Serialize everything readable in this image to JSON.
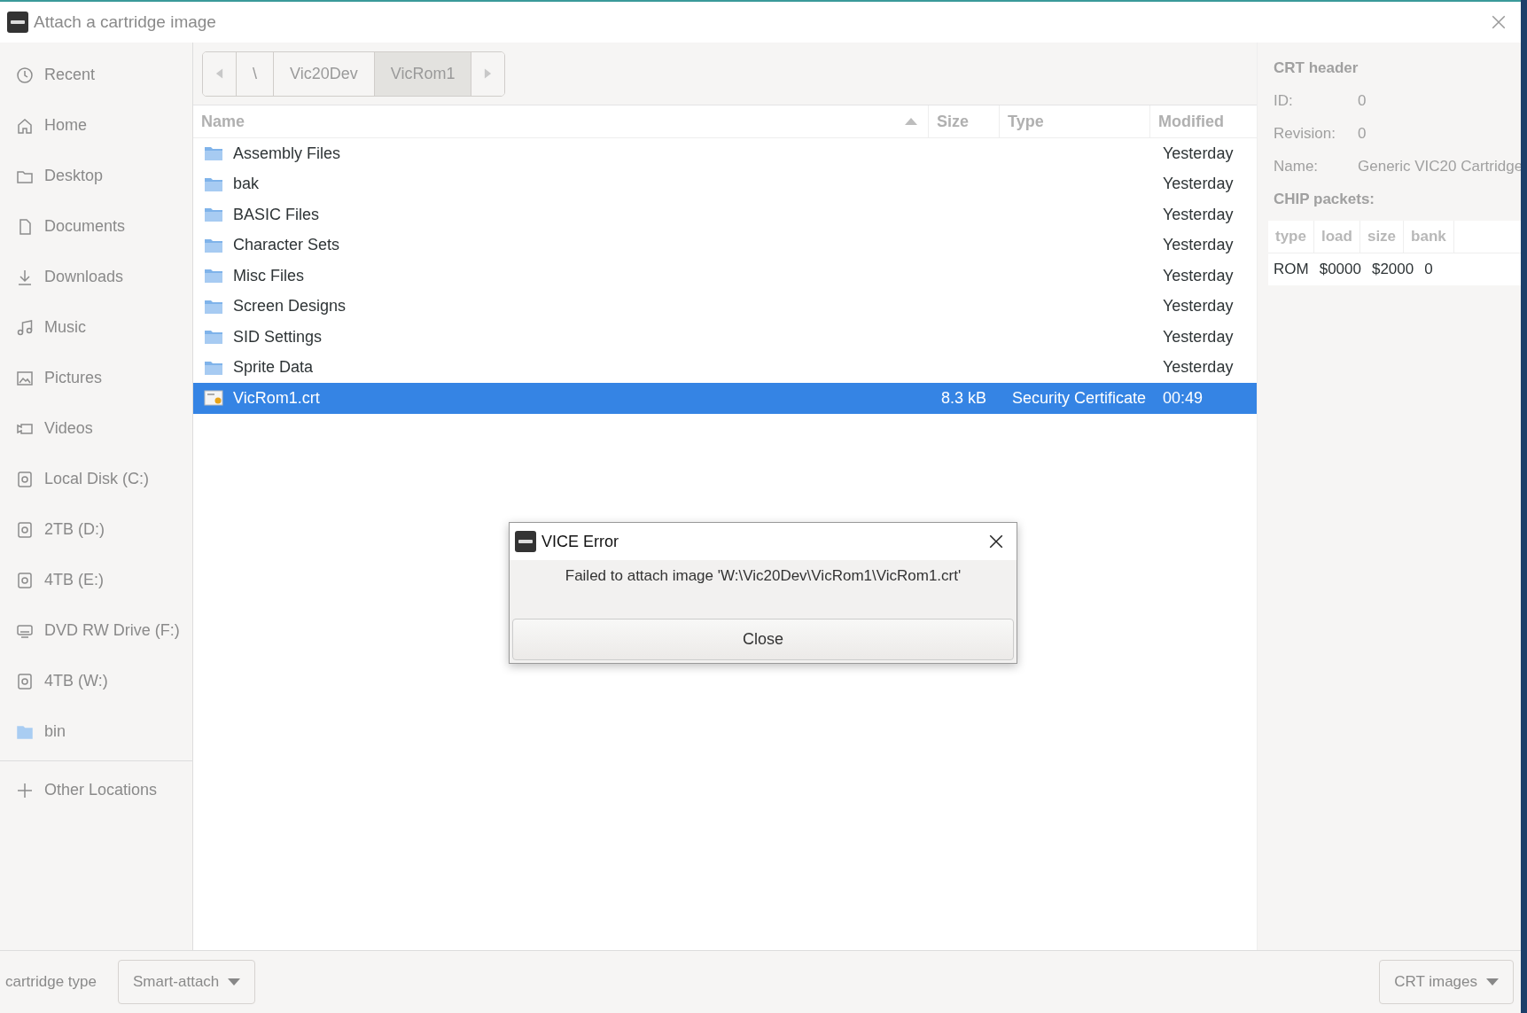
{
  "window": {
    "title": "Attach a cartridge image"
  },
  "sidebar": {
    "items": [
      {
        "kind": "recent",
        "label": "Recent"
      },
      {
        "kind": "home",
        "label": "Home"
      },
      {
        "kind": "folder",
        "label": "Desktop"
      },
      {
        "kind": "document",
        "label": "Documents"
      },
      {
        "kind": "download",
        "label": "Downloads"
      },
      {
        "kind": "music",
        "label": "Music"
      },
      {
        "kind": "picture",
        "label": "Pictures"
      },
      {
        "kind": "video",
        "label": "Videos"
      },
      {
        "kind": "disk",
        "label": "Local Disk (C:)"
      },
      {
        "kind": "disk",
        "label": "2TB (D:)"
      },
      {
        "kind": "disk",
        "label": "4TB (E:)"
      },
      {
        "kind": "optical",
        "label": "DVD RW Drive (F:)"
      },
      {
        "kind": "disk",
        "label": "4TB (W:)"
      },
      {
        "kind": "bluefolder",
        "label": "bin"
      }
    ],
    "other_locations": "Other Locations"
  },
  "path_bar": [
    {
      "label": "\\",
      "selected": false
    },
    {
      "label": "Vic20Dev",
      "selected": false
    },
    {
      "label": "VicRom1",
      "selected": true
    }
  ],
  "table": {
    "columns": [
      "Name",
      "Size",
      "Type",
      "Modified"
    ],
    "rows": [
      {
        "kind": "folder",
        "name": "Assembly Files",
        "size": "",
        "type": "",
        "modified": "Yesterday",
        "selected": false
      },
      {
        "kind": "folder",
        "name": "bak",
        "size": "",
        "type": "",
        "modified": "Yesterday",
        "selected": false
      },
      {
        "kind": "folder",
        "name": "BASIC Files",
        "size": "",
        "type": "",
        "modified": "Yesterday",
        "selected": false
      },
      {
        "kind": "folder",
        "name": "Character Sets",
        "size": "",
        "type": "",
        "modified": "Yesterday",
        "selected": false
      },
      {
        "kind": "folder",
        "name": "Misc Files",
        "size": "",
        "type": "",
        "modified": "Yesterday",
        "selected": false
      },
      {
        "kind": "folder",
        "name": "Screen Designs",
        "size": "",
        "type": "",
        "modified": "Yesterday",
        "selected": false
      },
      {
        "kind": "folder",
        "name": "SID Settings",
        "size": "",
        "type": "",
        "modified": "Yesterday",
        "selected": false
      },
      {
        "kind": "folder",
        "name": "Sprite Data",
        "size": "",
        "type": "",
        "modified": "Yesterday",
        "selected": false
      },
      {
        "kind": "certificate",
        "name": "VicRom1.crt",
        "size": "8.3 kB",
        "type": "Security Certificate",
        "modified": "00:49",
        "selected": true
      }
    ]
  },
  "crt_panel": {
    "title": "CRT header",
    "fields": [
      {
        "label": "ID:",
        "value": "0"
      },
      {
        "label": "Revision:",
        "value": "0"
      },
      {
        "label": "Name:",
        "value": "Generic VIC20 Cartridge"
      }
    ],
    "chip_title": "CHIP packets:",
    "chip_columns": [
      "type",
      "load",
      "size",
      "bank"
    ],
    "chip_rows": [
      [
        "ROM",
        "$0000",
        "$2000",
        "0"
      ]
    ]
  },
  "bottom_bar": {
    "label": "cartridge type",
    "type_dropdown": "Smart-attach",
    "filter_dropdown": "CRT images"
  },
  "dialog": {
    "title": "VICE Error",
    "message": "Failed to attach image 'W:\\Vic20Dev\\VicRom1\\VicRom1.crt'",
    "button": "Close"
  }
}
